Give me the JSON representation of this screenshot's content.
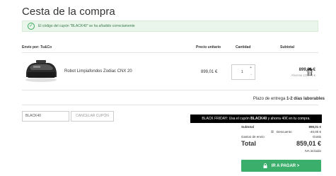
{
  "page": {
    "title": "Cesta de la compra"
  },
  "banner": {
    "message": "El código del cupón \"BLACK40\" se ha añadido correctamente",
    "icon": "check-circle-icon"
  },
  "table": {
    "headers": {
      "shipped_by": "Envío por: Tu&Co",
      "unit_price": "Precio unitario",
      "quantity": "Cantidad",
      "subtotal": "Subtotal"
    }
  },
  "product": {
    "name": "Robot Limpiafondos Zodiac CNX 20",
    "unit_price": "899,01 €",
    "quantity": "1",
    "subtotal": "899,01 €",
    "savings": "Ahorras 138,74 €"
  },
  "delivery": {
    "label": "Plazo de entrega",
    "days": "1-2 días laborables"
  },
  "coupon": {
    "input_value": "BLACK40",
    "cancel_label": "CANCELAR CUPÓN"
  },
  "promo": {
    "prefix": "BLACK FRIDAY: Usa el cupón ",
    "code": "BLACK40",
    "suffix": " y ahorra 40€ en tu compra."
  },
  "summary": {
    "subtotal_label": "Subtotal",
    "subtotal_value": "899,01 €",
    "discount_label": "Descuento",
    "discount_value": "-40,00 €",
    "shipping_label": "Gastos de envío",
    "shipping_value": "Gratis",
    "total_label": "Total",
    "total_value": "859,01 €",
    "tax_note": "IVA incluido"
  },
  "checkout": {
    "label": "IR A PAGAR >",
    "icon": "lock-icon"
  },
  "colors": {
    "accent_green": "#3aae6a",
    "banner_bg": "#eaf6ec",
    "promo_bg": "#000000"
  }
}
